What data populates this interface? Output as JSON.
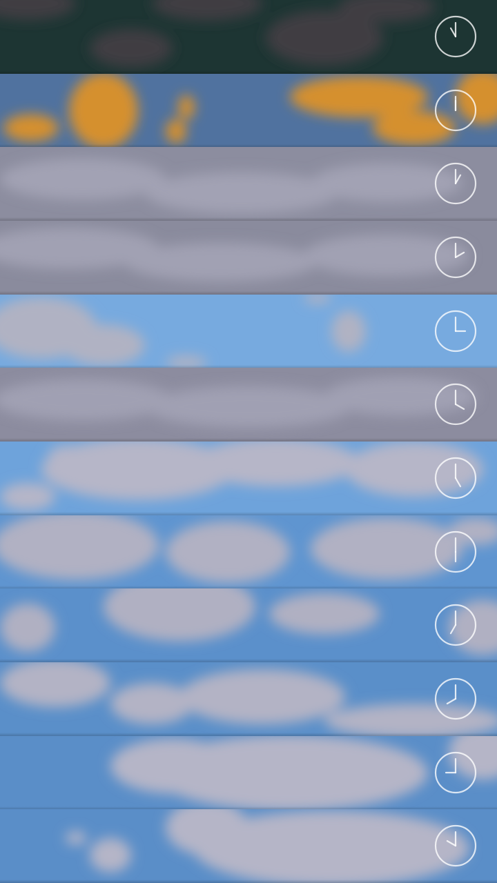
{
  "slots": [
    {
      "label": "night-storm",
      "sky": "#1d3533",
      "cloud": "#3f3c42",
      "hour": 11,
      "minute": 0,
      "clouds": [
        [
          40,
          5,
          70,
          24
        ],
        [
          190,
          70,
          60,
          28
        ],
        [
          300,
          5,
          80,
          25
        ],
        [
          470,
          55,
          85,
          40
        ],
        [
          560,
          10,
          70,
          22
        ]
      ]
    },
    {
      "label": "dusk-orange",
      "sky": "#50729f",
      "cloud": "#d5902e",
      "hour": 12,
      "minute": 0,
      "clouds": [
        [
          45,
          185,
          40,
          20
        ],
        [
          150,
          160,
          50,
          55
        ],
        [
          220,
          35,
          40,
          35
        ],
        [
          270,
          155,
          12,
          18
        ],
        [
          255,
          190,
          15,
          18
        ],
        [
          450,
          40,
          75,
          40
        ],
        [
          520,
          140,
          100,
          30
        ],
        [
          600,
          185,
          60,
          25
        ],
        [
          700,
          140,
          40,
          40
        ]
      ]
    },
    {
      "label": "overcast",
      "sky": "#8c8d9f",
      "cloud": "#a2a2b4",
      "hour": 1,
      "minute": 0,
      "clouds": [
        [
          120,
          260,
          120,
          30
        ],
        [
          350,
          280,
          140,
          30
        ],
        [
          560,
          265,
          110,
          28
        ]
      ]
    },
    {
      "label": "overcast",
      "sky": "#8a8b9d",
      "cloud": "#a1a1b3",
      "hour": 2,
      "minute": 0,
      "clouds": [
        [
          100,
          360,
          130,
          30
        ],
        [
          320,
          380,
          140,
          28
        ],
        [
          560,
          370,
          120,
          30
        ]
      ]
    },
    {
      "label": "mostly-clear",
      "sky": "#77aadf",
      "cloud": "#b0b2c3",
      "hour": 3,
      "minute": 0,
      "clouds": [
        [
          60,
          475,
          80,
          45
        ],
        [
          150,
          500,
          60,
          30
        ],
        [
          505,
          480,
          25,
          30
        ],
        [
          270,
          525,
          30,
          10
        ],
        [
          460,
          432,
          20,
          8
        ]
      ]
    },
    {
      "label": "overcast",
      "sky": "#8c8c9f",
      "cloud": "#a0a0b3",
      "hour": 4,
      "minute": 0,
      "clouds": [
        [
          120,
          580,
          130,
          30
        ],
        [
          360,
          590,
          150,
          30
        ],
        [
          580,
          575,
          110,
          28
        ]
      ]
    },
    {
      "label": "partly-cloudy",
      "sky": "#6ea3db",
      "cloud": "#b6b6c8",
      "hour": 5,
      "minute": 0,
      "clouds": [
        [
          200,
          680,
          140,
          45
        ],
        [
          400,
          670,
          120,
          35
        ],
        [
          600,
          680,
          100,
          40
        ],
        [
          40,
          720,
          40,
          20
        ],
        [
          100,
          660,
          30,
          15
        ]
      ]
    },
    {
      "label": "partly-cloudy",
      "sky": "#5f95d0",
      "cloud": "#b1b1c3",
      "hour": 6,
      "minute": 0,
      "clouds": [
        [
          110,
          790,
          120,
          50
        ],
        [
          330,
          800,
          90,
          45
        ],
        [
          560,
          795,
          110,
          45
        ],
        [
          690,
          770,
          40,
          20
        ]
      ]
    },
    {
      "label": "partly-cloudy",
      "sky": "#5b90cb",
      "cloud": "#b0b0c2",
      "hour": 7,
      "minute": 0,
      "clouds": [
        [
          260,
          880,
          110,
          50
        ],
        [
          40,
          910,
          40,
          35
        ],
        [
          470,
          890,
          80,
          30
        ],
        [
          700,
          910,
          50,
          40
        ]
      ]
    },
    {
      "label": "partly-cloudy",
      "sky": "#5a8fc9",
      "cloud": "#b3b3c5",
      "hour": 8,
      "minute": 0,
      "clouds": [
        [
          80,
          990,
          80,
          35
        ],
        [
          220,
          1020,
          60,
          30
        ],
        [
          380,
          1010,
          120,
          40
        ],
        [
          600,
          1045,
          130,
          25
        ]
      ]
    },
    {
      "label": "partly-cloudy",
      "sky": "#5a8ec8",
      "cloud": "#b5b5c7",
      "hour": 9,
      "minute": 0,
      "clouds": [
        [
          420,
          1120,
          200,
          55
        ],
        [
          250,
          1110,
          90,
          40
        ],
        [
          700,
          1090,
          50,
          40
        ]
      ]
    },
    {
      "label": "partly-cloudy",
      "sky": "#5a8ec8",
      "cloud": "#b5b5c7",
      "hour": 10,
      "minute": 0,
      "clouds": [
        [
          480,
          1230,
          200,
          55
        ],
        [
          300,
          1200,
          60,
          40
        ],
        [
          160,
          1240,
          30,
          25
        ],
        [
          110,
          1215,
          15,
          10
        ]
      ]
    }
  ],
  "clock_icon": "clock-icon"
}
